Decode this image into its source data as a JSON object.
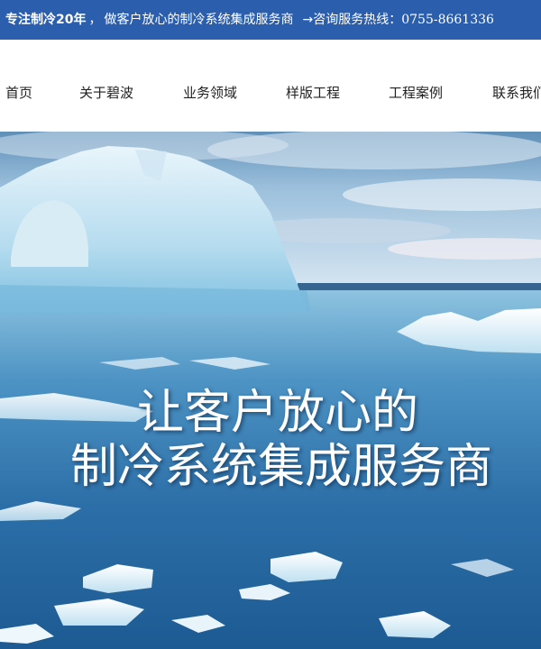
{
  "topbar": {
    "brand": "专注制冷20年",
    "separator": "，",
    "slogan": "做客户放心的制冷系统集成服务商",
    "arrow": "→",
    "hotline": "咨询服务热线：0755-8661336"
  },
  "nav": {
    "items": [
      "首页",
      "关于碧波",
      "业务领域",
      "样版工程",
      "工程案例",
      "联系我们"
    ]
  },
  "hero": {
    "title_line1": "让客户放心的",
    "title_line2": "制冷系统集成服务商"
  }
}
